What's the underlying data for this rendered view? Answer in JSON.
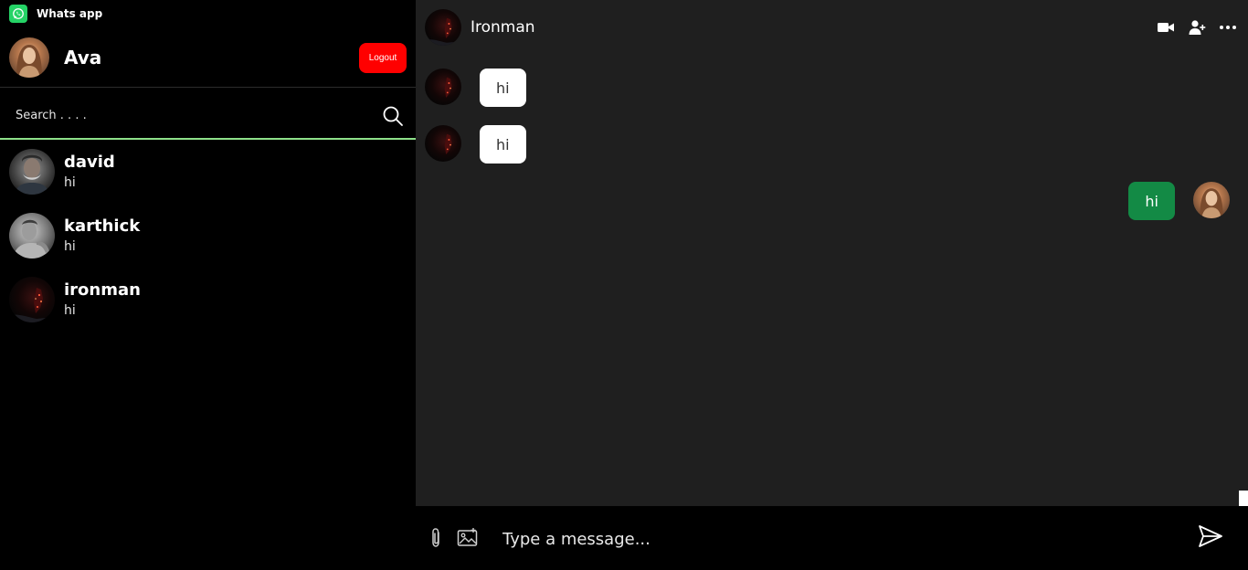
{
  "app": {
    "title": "Whats app"
  },
  "profile": {
    "name": "Ava",
    "logout_label": "Logout"
  },
  "search": {
    "placeholder": "Search . . . ."
  },
  "contacts": [
    {
      "name": "david",
      "last_message": "hi"
    },
    {
      "name": "karthick",
      "last_message": "hi"
    },
    {
      "name": "ironman",
      "last_message": "hi"
    }
  ],
  "chat": {
    "header_name": "Ironman",
    "header_icons": [
      "video-call-icon",
      "add-user-icon",
      "more-options-icon"
    ],
    "messages": [
      {
        "direction": "incoming",
        "text": "hi"
      },
      {
        "direction": "incoming",
        "text": "hi"
      },
      {
        "direction": "outgoing",
        "text": "hi"
      }
    ]
  },
  "composer": {
    "placeholder": "Type a message...",
    "icons": [
      "attach-icon",
      "image-icon",
      "send-icon"
    ]
  },
  "colors": {
    "sidebar_bg": "#000000",
    "chat_bg": "#1f1f1f",
    "logout": "#ff0000",
    "outgoing_bubble": "#138a45",
    "search_underline": "#8ee08a",
    "brand": "#25d366"
  }
}
